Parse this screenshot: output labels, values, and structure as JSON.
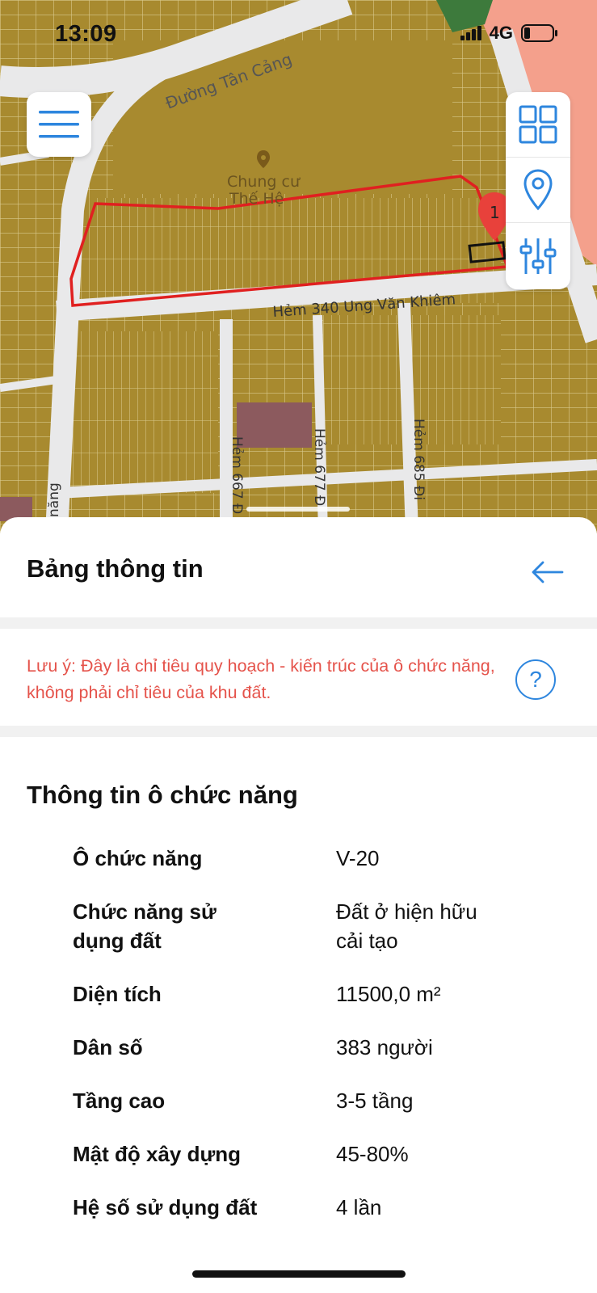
{
  "status_bar": {
    "time": "13:09",
    "network": "4G"
  },
  "map": {
    "street_labels": {
      "tan_cang": "Đường Tân Cảng",
      "building": "Chung cư",
      "building_cut": "Thế Hệ",
      "alley_340": "Hẻm 340 Ung Văn Khiêm",
      "alley_667": "Hẻm 667 Đ",
      "alley_677": "Hẻm 677 Đ",
      "alley_685": "Hẻm 685 Đi",
      "left_street": "năng",
      "marker_label": "1"
    },
    "colors": {
      "residential": "#a88a2f",
      "road": "#e9e9ea",
      "highlight": "#e02020",
      "commercial": "#f4a08c",
      "park": "#3d7a3c",
      "public": "#8c5a5e"
    }
  },
  "controls": {
    "menu_icon": "hamburger-menu-icon",
    "grid_icon": "grid-icon",
    "location_icon": "location-pin-icon",
    "filter_icon": "sliders-icon"
  },
  "sheet": {
    "title": "Bảng thông tin",
    "note": "Lưu ý: Đây là chỉ tiêu quy hoạch - kiến trúc của ô chức năng, không phải chỉ tiêu của khu đất.",
    "help_symbol": "?",
    "section_title": "Thông tin ô chức năng",
    "rows": [
      {
        "label": "Ô chức năng",
        "value": "V-20"
      },
      {
        "label": "Chức năng sử dụng đất",
        "value": "Đất ở hiện hữu cải tạo"
      },
      {
        "label": "Diện tích",
        "value": "11500,0 m²"
      },
      {
        "label": "Dân số",
        "value": "383 người"
      },
      {
        "label": "Tầng cao",
        "value": "3-5 tầng"
      },
      {
        "label": "Mật độ xây dựng",
        "value": "45-80%"
      },
      {
        "label": "Hệ số sử dụng đất",
        "value": "4 lần"
      }
    ]
  }
}
